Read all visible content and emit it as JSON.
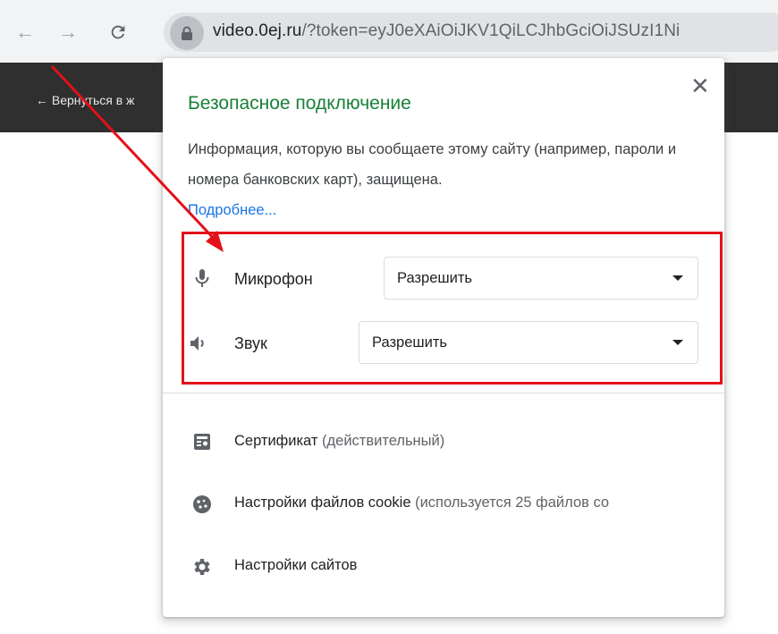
{
  "browser": {
    "url_domain": "video.0ej.ru",
    "url_rest": "/?token=eyJ0eXAiOiJKV1QiLCJhbGciOiJSUzI1Ni"
  },
  "page": {
    "back_link": "← Вернуться в ж"
  },
  "popup": {
    "title": "Безопасное подключение",
    "description": "Информация, которую вы сообщаете этому сайту (например, пароли и номера банковских карт), защищена.",
    "more_link": "Подробнее...",
    "permissions": [
      {
        "label": "Микрофон",
        "value": "Разрешить",
        "icon": "microphone-icon"
      },
      {
        "label": "Звук",
        "value": "Разрешить",
        "icon": "speaker-icon"
      }
    ],
    "menu": [
      {
        "label": "Сертификат",
        "sub": " (действительный)",
        "icon": "certificate-icon"
      },
      {
        "label": "Настройки файлов cookie",
        "sub": " (используется 25 файлов со",
        "icon": "cookie-icon"
      },
      {
        "label": "Настройки сайтов",
        "sub": "",
        "icon": "gear-icon"
      }
    ]
  },
  "annotation": {
    "color": "#e41018"
  }
}
